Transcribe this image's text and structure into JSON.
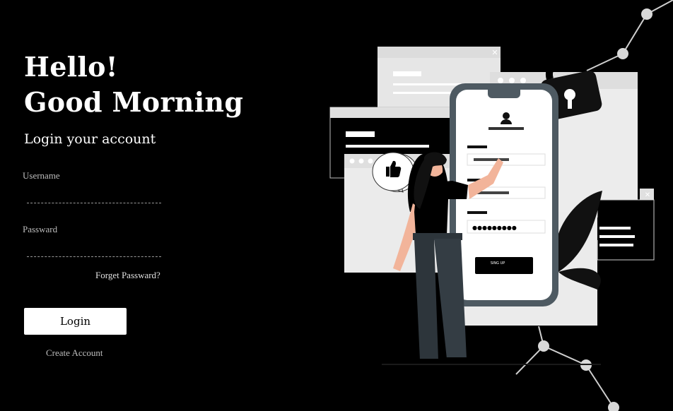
{
  "greeting": {
    "line1": "Hello!",
    "line2": "Good Morning"
  },
  "subtitle": "Login your account",
  "form": {
    "username_label": "Username",
    "password_label": "Passward",
    "forgot_label": "Forget Passward?",
    "login_label": "Login",
    "create_label": "Create Account"
  },
  "illustration": {
    "phone_button_label": "SING UP",
    "password_dots": "●●●●●●●●●"
  }
}
